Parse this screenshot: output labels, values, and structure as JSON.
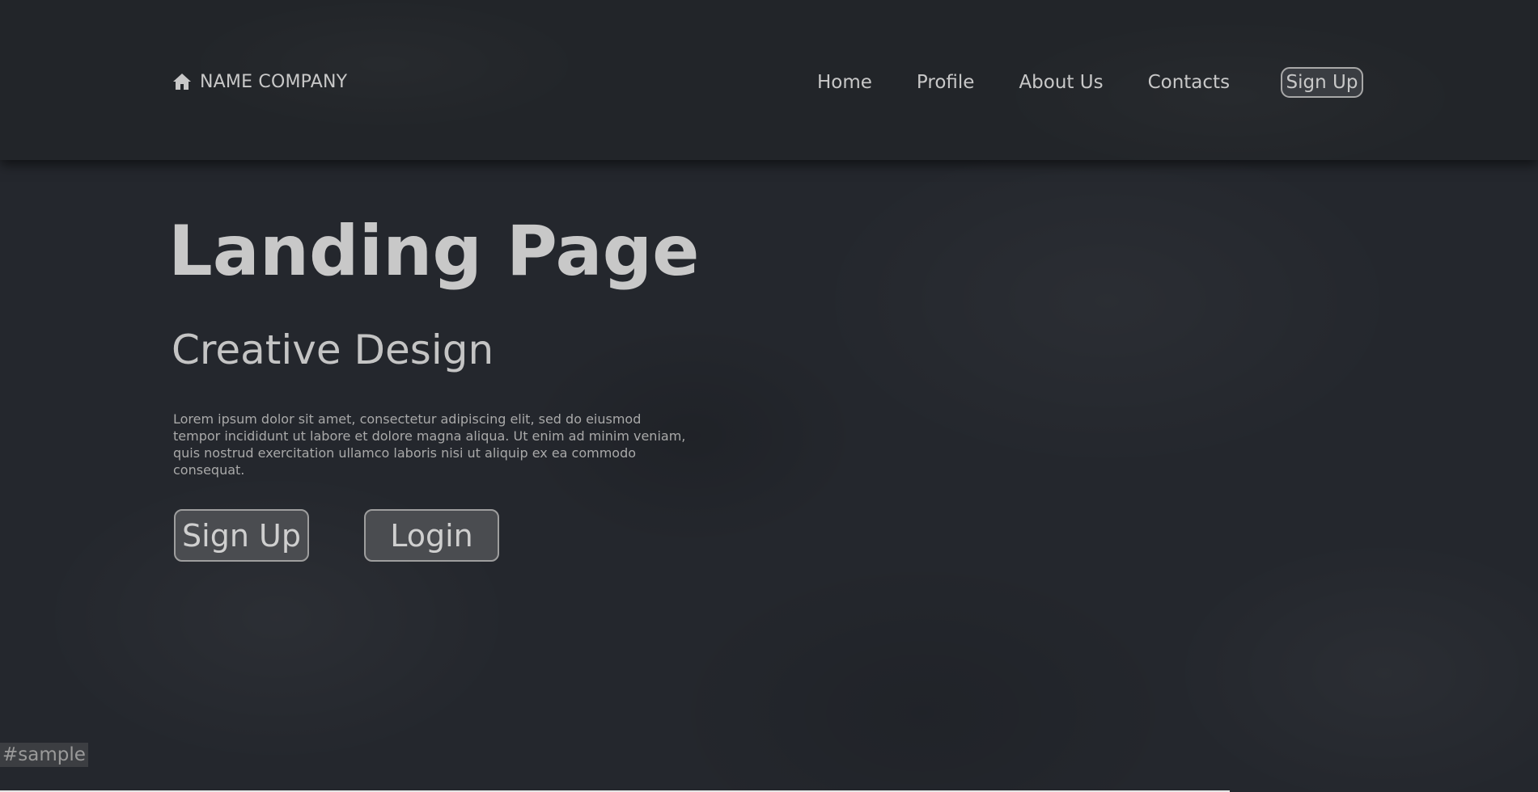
{
  "header": {
    "logo_icon": "home-icon",
    "company_name": "NAME COMPANY",
    "nav": [
      {
        "label": "Home"
      },
      {
        "label": "Profile"
      },
      {
        "label": "About Us"
      },
      {
        "label": "Contacts"
      }
    ],
    "signup_label": "Sign Up"
  },
  "hero": {
    "title": "Landing Page",
    "subtitle": "Creative Design",
    "body": "Lorem ipsum dolor sit amet, consectetur adipiscing elit, sed do eiusmod tempor incididunt ut labore et dolore magna aliqua. Ut enim ad minim veniam, quis nostrud exercitation ullamco laboris nisi ut aliquip ex ea commodo consequat.",
    "signup_label": "Sign Up",
    "login_label": "Login"
  },
  "watermark": "#sample",
  "colors": {
    "background": "#24272d",
    "header": "#222529",
    "text": "#c8c8c8",
    "button_fill": "#4a4c50",
    "button_border": "#9e9e9e"
  }
}
